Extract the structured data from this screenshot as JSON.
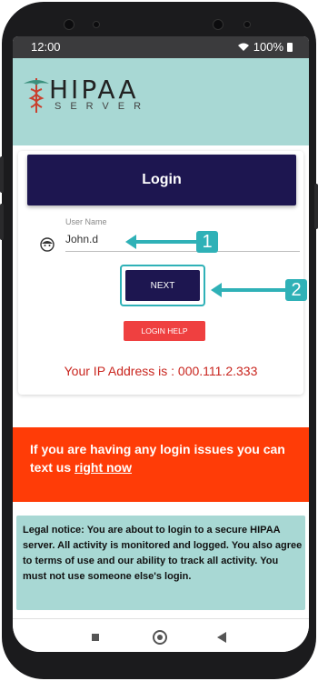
{
  "status": {
    "time": "12:00",
    "battery": "100%"
  },
  "header": {
    "logo_main": "HIPAA",
    "logo_sub": "SERVER"
  },
  "login": {
    "title": "Login",
    "username_label": "User Name",
    "username_value": "John.d",
    "next_label": "NEXT",
    "help_label": "LOGIN HELP",
    "ip_text": "Your IP Address is : 000.111.2.333"
  },
  "callouts": [
    "1",
    "2"
  ],
  "alert": {
    "text": "If you are having any login issues you can text us ",
    "link": "right now"
  },
  "legal": {
    "text": "Legal notice: You are about to login to a secure HIPAA server. All activity is monitored and logged. You also agree to terms of use and our ability to track all activity. You must not use someone else's login."
  },
  "colors": {
    "accent": "#2fb1b7",
    "header_bg": "#a8d8d4",
    "primary": "#1d1650",
    "alert": "#ff3c07",
    "danger": "#ef4040"
  },
  "icons": {
    "user": "user-face-icon",
    "wifi": "wifi-icon",
    "battery": "battery-icon"
  }
}
